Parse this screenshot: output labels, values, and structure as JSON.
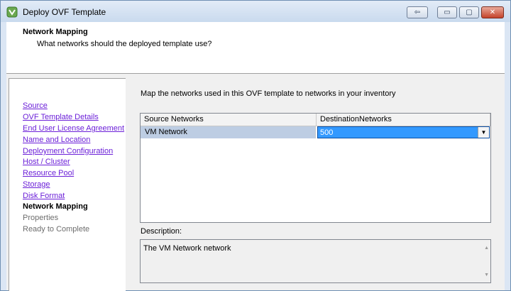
{
  "window": {
    "title": "Deploy OVF Template",
    "controls": {
      "help": "⇦",
      "minimize": "▭",
      "maximize": "▢",
      "close": "✕"
    }
  },
  "header": {
    "title": "Network Mapping",
    "subtitle": "What networks should the deployed template use?"
  },
  "nav": {
    "items": [
      {
        "label": "Source",
        "state": "link"
      },
      {
        "label": "OVF Template Details",
        "state": "link"
      },
      {
        "label": "End User License Agreement",
        "state": "link"
      },
      {
        "label": "Name and Location",
        "state": "link"
      },
      {
        "label": "Deployment Configuration",
        "state": "link"
      },
      {
        "label": "Host / Cluster",
        "state": "link"
      },
      {
        "label": "Resource Pool",
        "state": "link"
      },
      {
        "label": "Storage",
        "state": "link"
      },
      {
        "label": "Disk Format",
        "state": "link"
      },
      {
        "label": "Network Mapping",
        "state": "current"
      },
      {
        "label": "Properties",
        "state": "disabled"
      },
      {
        "label": "Ready to Complete",
        "state": "disabled"
      }
    ]
  },
  "main": {
    "instruction": "Map the networks used in this OVF template to networks in your inventory",
    "grid": {
      "columns": [
        "Source Networks",
        "DestinationNetworks"
      ],
      "rows": [
        {
          "source": "VM Network",
          "destination": "500"
        }
      ]
    },
    "description_label": "Description:",
    "description_text": "The VM Network network"
  },
  "icons": {
    "app": "vsphere-logo-icon",
    "dropdown": "▼",
    "scroll_up": "▲",
    "scroll_down": "▼"
  },
  "colors": {
    "link": "#6b1fd8",
    "selection": "#3399ff",
    "source_cell": "#bdcde3"
  }
}
